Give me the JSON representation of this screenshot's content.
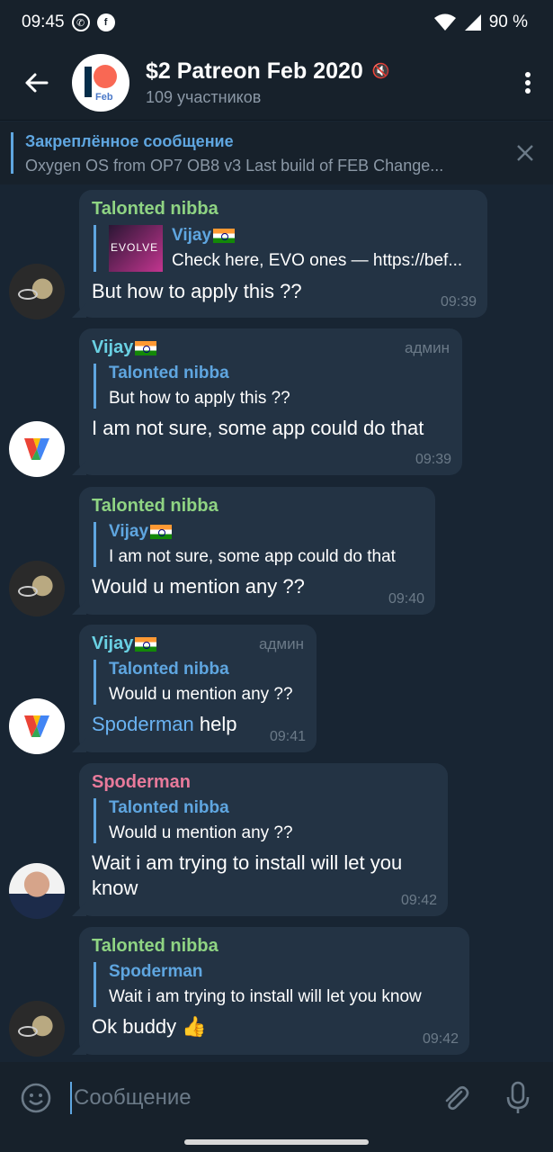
{
  "status_bar": {
    "time": "09:45",
    "battery": "90 %"
  },
  "header": {
    "title": "$2 Patreon Feb 2020",
    "subtitle": "109 участников",
    "avatar_text": "Feb"
  },
  "pinned": {
    "title": "Закреплённое сообщение",
    "text": "Oxygen OS from OP7 OB8 v3 Last build of FEB  Change..."
  },
  "messages": [
    {
      "sender": "Talonted nibba",
      "reply_name": "Vijay",
      "reply_text": "Check here, EVO ones — https://bef...",
      "reply_thumb": "EVOLVE",
      "text": "But how to apply this ??",
      "time": "09:39"
    },
    {
      "sender": "Vijay",
      "admin": "админ",
      "reply_name": "Talonted nibba",
      "reply_text": "But how to apply this ??",
      "text": "I am not sure, some app could do that",
      "time": "09:39"
    },
    {
      "sender": "Talonted nibba",
      "reply_name": "Vijay",
      "reply_text": "I am not sure, some app could do that",
      "text": "Would u mention any ??",
      "time": "09:40"
    },
    {
      "sender": "Vijay",
      "admin": "админ",
      "reply_name": "Talonted nibba",
      "reply_text": "Would u mention any ??",
      "mention": "Spoderman",
      "text": "help",
      "time": "09:41"
    },
    {
      "sender": "Spoderman",
      "reply_name": "Talonted nibba",
      "reply_text": "Would u mention any ??",
      "text_line1": "Wait i am trying to install will let you",
      "text_line2": "know",
      "time": "09:42"
    },
    {
      "sender": "Talonted nibba",
      "reply_name": "Spoderman",
      "reply_text": "Wait i am trying to install will let you know",
      "text": "Ok buddy 👍",
      "time": "09:42"
    }
  ],
  "input": {
    "placeholder": "Сообщение"
  },
  "colors": {
    "accent": "#5fa6e0",
    "bubble": "#233344",
    "background": "#182533",
    "header": "#17212b"
  }
}
